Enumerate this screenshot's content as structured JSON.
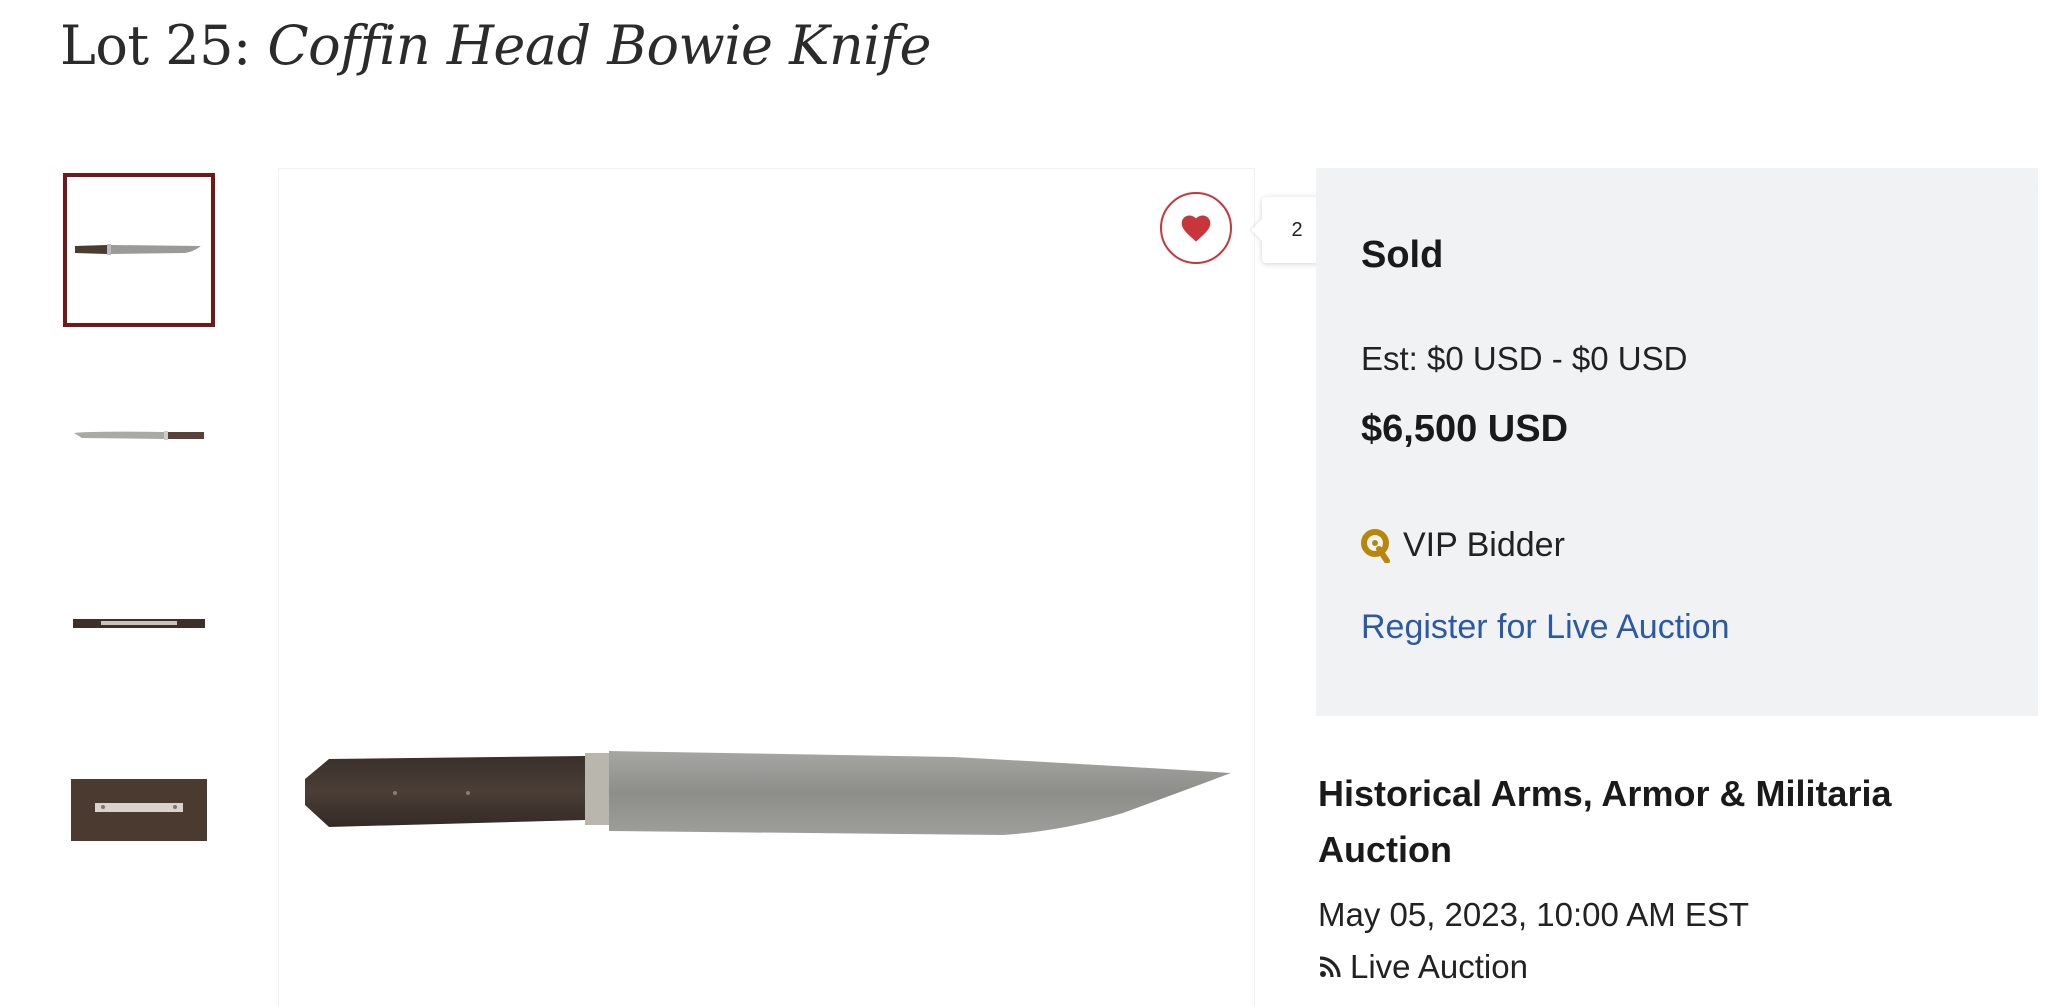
{
  "lot": {
    "prefix": "Lot 25: ",
    "name": "Coffin Head Bowie Knife"
  },
  "thumbnails": [
    {
      "icon": "knife-thumbnail-full-view",
      "active": true
    },
    {
      "icon": "knife-thumbnail-reverse-view",
      "active": false
    },
    {
      "icon": "knife-thumbnail-spine-view",
      "active": false
    },
    {
      "icon": "knife-thumbnail-handle-detail",
      "active": false
    }
  ],
  "favorite": {
    "icon": "heart-icon",
    "count": "2"
  },
  "status": {
    "sold_label": "Sold",
    "estimate": "Est: $0 USD - $0 USD",
    "price": "$6,500 USD",
    "vip_icon": "vip-badge-icon",
    "vip_label": "VIP Bidder",
    "register_link": "Register for Live Auction"
  },
  "auction": {
    "name": "Historical Arms, Armor & Militaria Auction",
    "date": "May 05, 2023, 10:00 AM EST",
    "type_icon": "rss-icon",
    "type": "Live Auction"
  },
  "colors": {
    "accent_red": "#c8363b",
    "thumb_border": "#6e1a1a",
    "link_blue": "#2a5aa7",
    "panel_bg": "#f1f2f4",
    "vip_gold": "#b8860b"
  }
}
